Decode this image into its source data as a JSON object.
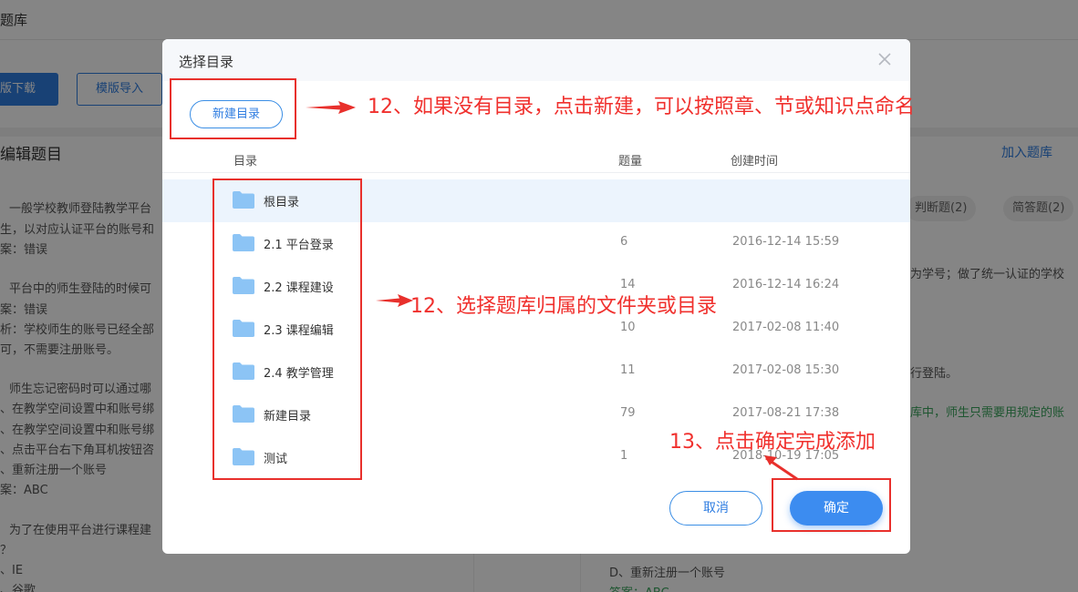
{
  "background": {
    "page_title": "题库",
    "download_button": "版下载",
    "import_button": "模版导入",
    "edit_title": "编辑题目",
    "add_to_bank": "加入题库",
    "filter_chips": [
      "判断题(2)",
      "简答题(2)"
    ],
    "left_lines": [
      "一般学校教师登陆教学平台",
      "生，以对应认证平台的账号和",
      "案：错误",
      "平台中的师生登陆的时候可",
      "案：错误",
      "析：学校师生的账号已经全部",
      "可，不需要注册账号。",
      "师生忘记密码时可以通过哪",
      "、在教学空间设置中和账号绑",
      "、在教学空间设置中和账号绑",
      "、点击平台右下角耳机按钮咨",
      "、重新注册一个账号",
      "案：ABC",
      "为了在使用平台进行课程建",
      "？",
      "、IE",
      "、谷歌"
    ],
    "right_lines": [
      "为学号；做了统一认证的学校",
      "行登陆。",
      "库中，师生只需要用规定的账",
      "D、重新注册一个账号",
      "答案：ABC"
    ]
  },
  "dialog": {
    "title": "选择目录",
    "close_icon": "close-icon",
    "new_folder_button": "新建目录",
    "columns": {
      "name": "目录",
      "count": "题量",
      "created": "创建时间"
    },
    "rows": [
      {
        "name": "根目录",
        "count": "",
        "created": "",
        "selected": true
      },
      {
        "name": "2.1 平台登录",
        "count": "6",
        "created": "2016-12-14 15:59"
      },
      {
        "name": "2.2 课程建设",
        "count": "14",
        "created": "2016-12-14 16:24"
      },
      {
        "name": "2.3 课程编辑",
        "count": "10",
        "created": "2017-02-08 11:40"
      },
      {
        "name": "2.4 教学管理",
        "count": "11",
        "created": "2017-02-08 15:30"
      },
      {
        "name": "新建目录",
        "count": "79",
        "created": "2017-08-21 17:38"
      },
      {
        "name": "测试",
        "count": "1",
        "created": "2018-10-19 17:05"
      }
    ],
    "cancel_button": "取消",
    "confirm_button": "确定",
    "folder_icon": "folder-icon",
    "folder_color": "#8cc4f5",
    "accent_color": "#3c8cf0"
  },
  "annotations": {
    "note_new": "12、如果没有目录，点击新建，可以按照章、节或知识点命名",
    "note_select": "12、选择题库归属的文件夹或目录",
    "note_confirm": "13、点击确定完成添加",
    "color": "#e8302c"
  }
}
